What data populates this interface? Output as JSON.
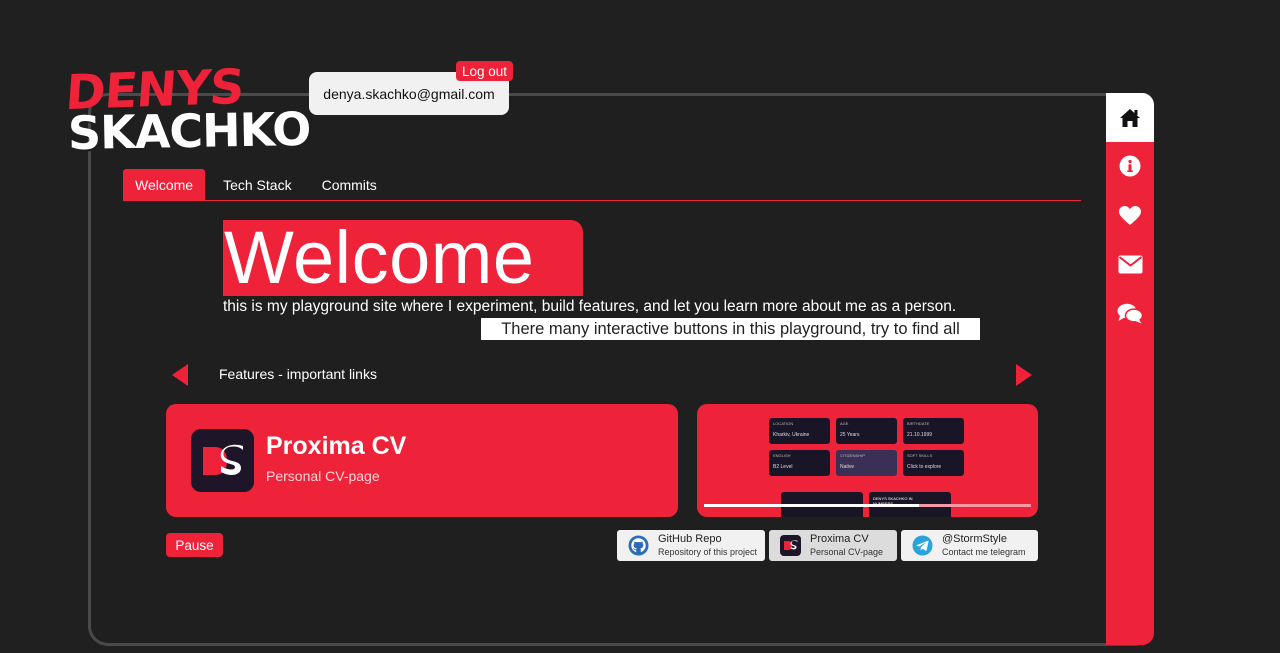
{
  "logo": {
    "line1": "DENYS",
    "line2": "SKACHKO"
  },
  "user": {
    "email": "denya.skachko@gmail.com",
    "logout_label": "Log out"
  },
  "colors": {
    "accent": "#ee2238",
    "background": "#202020",
    "panel": "#f1f1f1"
  },
  "sidebar": {
    "items": [
      {
        "icon": "home-icon"
      },
      {
        "icon": "info-icon"
      },
      {
        "icon": "heart-icon"
      },
      {
        "icon": "mail-icon"
      },
      {
        "icon": "chat-icon"
      }
    ]
  },
  "tabs": [
    {
      "label": "Welcome",
      "active": true
    },
    {
      "label": "Tech Stack",
      "active": false
    },
    {
      "label": "Commits",
      "active": false
    }
  ],
  "hero": {
    "title": "Welcome",
    "intro": "this is my playground site where I experiment, build features, and let you learn more about me as a person.",
    "hint": "There many interactive buttons in this playground, try to find all"
  },
  "carousel": {
    "label": "Features - important links",
    "card": {
      "logo_text": "DS",
      "title": "Proxima CV",
      "subtitle": "Personal CV-page"
    },
    "preview": {
      "tiles": [
        {
          "label": "LOCATION",
          "value": "Kharkiv, Ukraine"
        },
        {
          "label": "AGE",
          "value": "25 Years"
        },
        {
          "label": "BIRTHDATE",
          "value": "21.10.1999"
        },
        {
          "label": "ENGLISH",
          "value": "B2 Level"
        },
        {
          "label": "CITIZENSHIP",
          "value": "Native"
        },
        {
          "label": "SOFT SKILLS",
          "value": "Click to explore"
        }
      ],
      "caption": "DENYS SKACHKO IN NUMBERS"
    },
    "pause_label": "Pause"
  },
  "links": [
    {
      "title": "GitHub Repo",
      "subtitle": "Repository of this project",
      "icon": "github-icon"
    },
    {
      "title": "Proxima CV",
      "subtitle": "Personal CV-page",
      "icon": "ds-logo-icon"
    },
    {
      "title": "@StormStyle",
      "subtitle": "Contact me telegram",
      "icon": "telegram-icon"
    }
  ]
}
